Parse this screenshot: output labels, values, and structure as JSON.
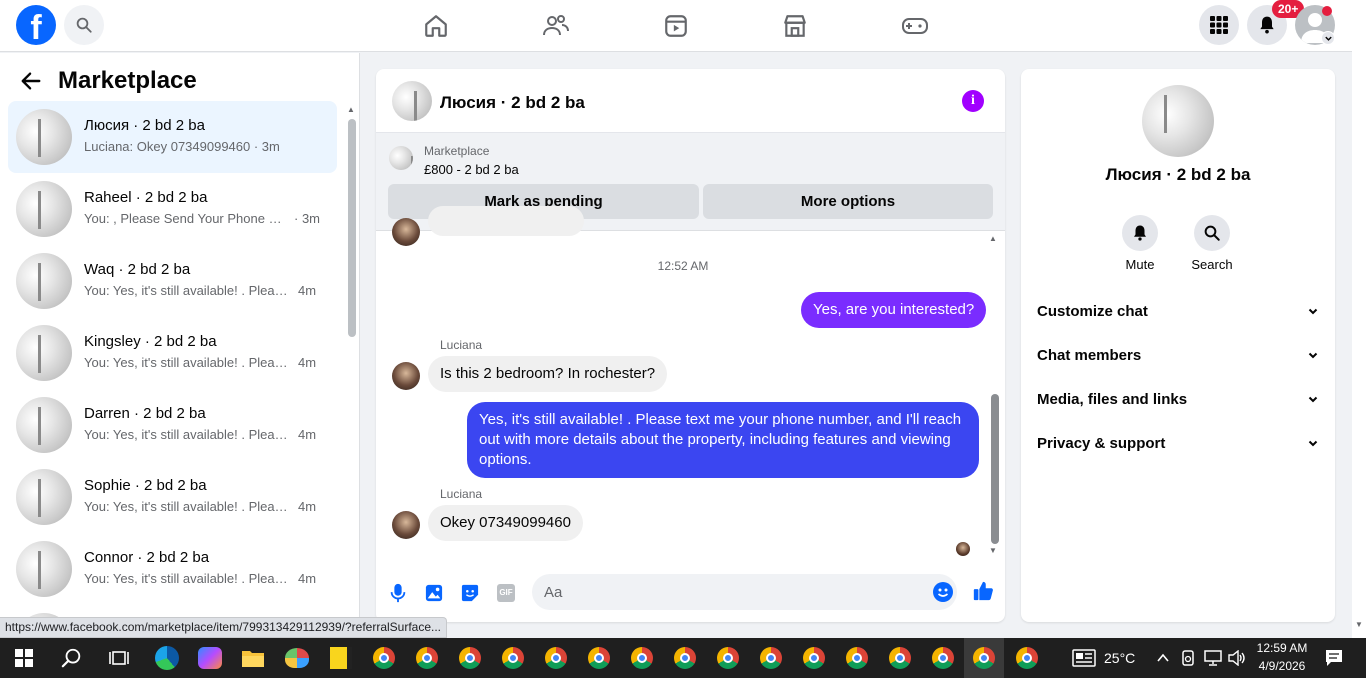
{
  "topnav": {
    "logo": "f",
    "notification_badge": "20+"
  },
  "sidebar": {
    "title": "Marketplace",
    "conversations": [
      {
        "name": "Люсия · 2 bd 2 ba",
        "preview": "Luciana: Okey 07349099460 · 3m",
        "time": "",
        "active": true
      },
      {
        "name": "Raheel · 2 bd 2 ba",
        "preview": "You: , Please Send Your Phone Nu...",
        "time": "· 3m",
        "active": false
      },
      {
        "name": "Waq · 2 bd 2 ba",
        "preview": "You: Yes, it's still available! . Please ...",
        "time": "4m",
        "active": false
      },
      {
        "name": "Kingsley · 2 bd 2 ba",
        "preview": "You: Yes, it's still available! . Please ...",
        "time": "4m",
        "active": false
      },
      {
        "name": "Darren · 2 bd 2 ba",
        "preview": "You: Yes, it's still available! . Please ...",
        "time": "4m",
        "active": false
      },
      {
        "name": "Sophie · 2 bd 2 ba",
        "preview": "You: Yes, it's still available! . Please ...",
        "time": "4m",
        "active": false
      },
      {
        "name": "Connor · 2 bd 2 ba",
        "preview": "You: Yes, it's still available! . Please ...",
        "time": "4m",
        "active": false
      }
    ]
  },
  "chat": {
    "title": "Люсия · 2 bd 2 ba",
    "marketplace_label": "Marketplace",
    "listing": "£800 - 2 bd 2 ba",
    "mark_pending": "Mark as pending",
    "more_options": "More options",
    "timestamp": "12:52 AM",
    "messages": {
      "out1": "Yes, are you interested?",
      "sender1": "Luciana",
      "in1": "Is this 2 bedroom? In rochester?",
      "out2": "Yes, it's still available! . Please text me your phone number, and I'll reach out with more details about the property, including features and viewing options.",
      "sender2": "Luciana",
      "in2": "Okey 07349099460"
    },
    "composer_placeholder": "Aa",
    "gif_label": "GIF"
  },
  "details": {
    "name": "Люсия · 2 bd 2 ba",
    "mute": "Mute",
    "search": "Search",
    "sections": [
      "Customize chat",
      "Chat members",
      "Media, files and links",
      "Privacy & support"
    ]
  },
  "statusbar": {
    "url": "https://www.facebook.com/marketplace/item/799313429112939/?referralSurface..."
  },
  "taskbar": {
    "temperature": "25°C",
    "time": "12:59 AM",
    "date": "4/9/2026"
  },
  "colors": {
    "facebook_blue": "#0866ff",
    "outgoing_bubble": "#7a2cff",
    "outgoing_bubble_long": "#3b46f1",
    "active_conversation": "#ebf5ff",
    "badge_red": "#e41e3f"
  }
}
